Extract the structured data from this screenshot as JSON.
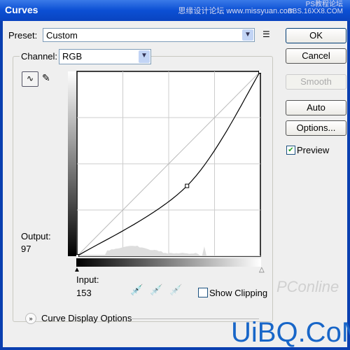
{
  "window": {
    "title": "Curves"
  },
  "watermarks": {
    "top_left": "思缘设计论坛 www.missyuan.com",
    "top_right_1": "PS教程论坛",
    "top_right_2": "BBS.16XX8.COM",
    "bottom": "UiBQ.CoM",
    "bottom_faded": "PConline"
  },
  "preset": {
    "label": "Preset:",
    "value": "Custom"
  },
  "channel": {
    "label": "Channel:",
    "value": "RGB"
  },
  "buttons": {
    "ok": "OK",
    "cancel": "Cancel",
    "smooth": "Smooth",
    "auto": "Auto",
    "options": "Options..."
  },
  "preview": {
    "label": "Preview",
    "checked": true
  },
  "output": {
    "label": "Output:",
    "value": "97"
  },
  "input": {
    "label": "Input:",
    "value": "153"
  },
  "show_clipping": {
    "label": "Show Clipping",
    "checked": false
  },
  "curve_display_options": "Curve Display Options",
  "curve": {
    "points": [
      [
        0,
        0
      ],
      [
        153,
        97
      ],
      [
        255,
        255
      ]
    ],
    "range": [
      0,
      255
    ],
    "grid": 4
  }
}
